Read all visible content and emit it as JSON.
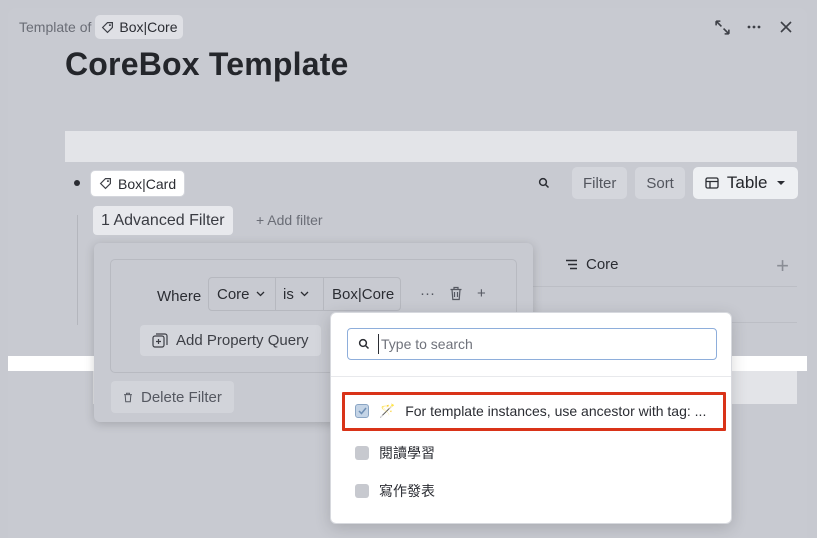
{
  "header": {
    "template_of_label": "Template of",
    "template_tag": "Box|Core",
    "title": "CoreBox Template"
  },
  "block": {
    "tag": "Box|Card"
  },
  "toolbar": {
    "filter_label": "Filter",
    "sort_label": "Sort",
    "view_label": "Table"
  },
  "filters": {
    "advanced_label": "1 Advanced Filter",
    "add_label": "+ Add filter"
  },
  "table": {
    "column_core": "Core"
  },
  "filter_popover": {
    "where_label": "Where",
    "property": "Core",
    "operator": "is",
    "value": "Box|Core",
    "more_label": "···",
    "add_label": "+",
    "add_property_query_label": "Add Property Query",
    "delete_filter_label": "Delete Filter"
  },
  "dropdown": {
    "search_placeholder": "Type to search",
    "options": [
      {
        "label": "For template instances, use ancestor with tag: ...",
        "checked": true,
        "emoji": "🪄"
      },
      {
        "label": "閱讀學習",
        "checked": false
      },
      {
        "label": "寫作發表",
        "checked": false
      }
    ]
  },
  "colors": {
    "highlight": "#d93318",
    "panel": "#c8cad1"
  }
}
